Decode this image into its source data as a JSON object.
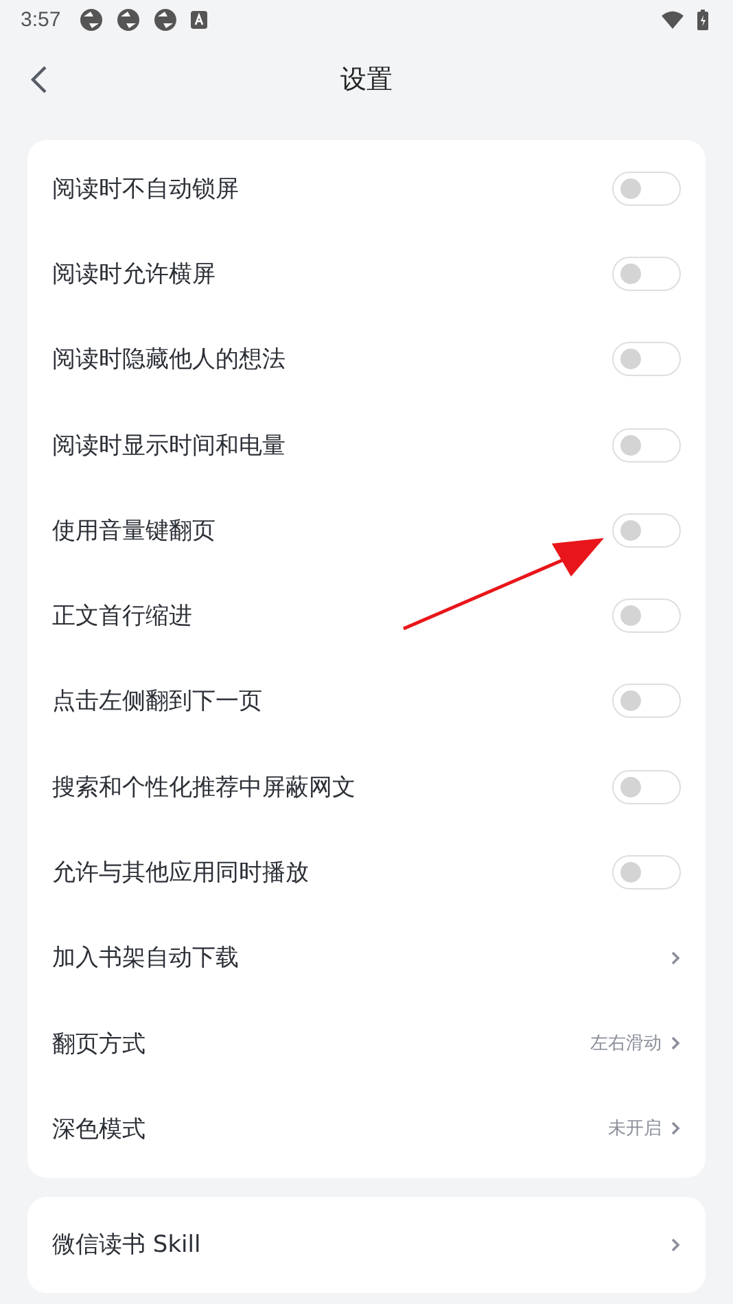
{
  "status_bar": {
    "time": "3:57",
    "notification_icons": [
      {
        "kind": "app"
      },
      {
        "kind": "app"
      },
      {
        "kind": "app"
      },
      {
        "kind": "text"
      }
    ]
  },
  "header": {
    "title": "设置"
  },
  "settings": [
    {
      "kind": "toggle",
      "label": "阅读时不自动锁屏",
      "on": false
    },
    {
      "kind": "toggle",
      "label": "阅读时允许横屏",
      "on": false
    },
    {
      "kind": "toggle",
      "label": "阅读时隐藏他人的想法",
      "on": false
    },
    {
      "kind": "toggle",
      "label": "阅读时显示时间和电量",
      "on": false
    },
    {
      "kind": "toggle",
      "label": "使用音量键翻页",
      "on": false
    },
    {
      "kind": "toggle",
      "label": "正文首行缩进",
      "on": false
    },
    {
      "kind": "toggle",
      "label": "点击左侧翻到下一页",
      "on": false
    },
    {
      "kind": "toggle",
      "label": "搜索和个性化推荐中屏蔽网文",
      "on": false
    },
    {
      "kind": "toggle",
      "label": "允许与其他应用同时播放",
      "on": false
    },
    {
      "kind": "link",
      "label": "加入书架自动下载"
    },
    {
      "kind": "link",
      "label": "翻页方式",
      "value": "左右滑动"
    },
    {
      "kind": "link",
      "label": "深色模式",
      "value": "未开启"
    }
  ],
  "more_settings": [
    {
      "kind": "link",
      "label": "微信读书 Skill"
    }
  ]
}
